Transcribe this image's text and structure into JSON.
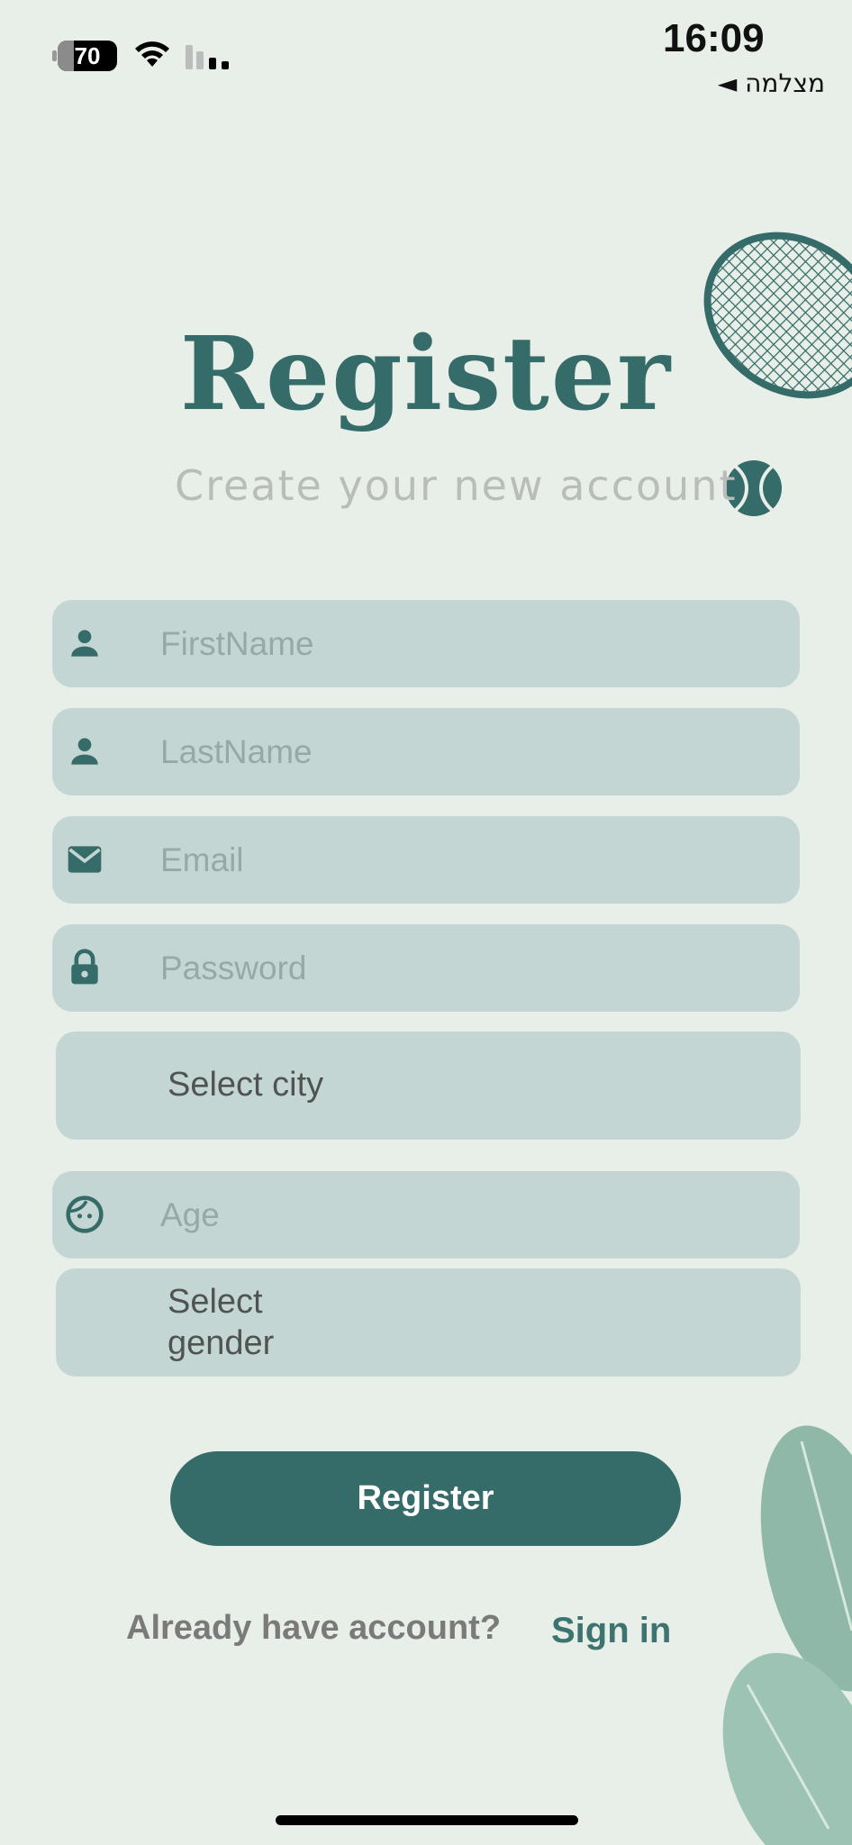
{
  "status_bar": {
    "time": "16:09",
    "back_app": "מצלמה ◄",
    "battery": "70",
    "icons": [
      "battery-icon",
      "wifi-icon",
      "cellular-signal-icon"
    ]
  },
  "header": {
    "title": "Register",
    "subtitle": "Create your new account"
  },
  "form": {
    "first_name": {
      "placeholder": "FirstName",
      "icon": "person-icon"
    },
    "last_name": {
      "placeholder": "LastName",
      "icon": "person-icon"
    },
    "email": {
      "placeholder": "Email",
      "icon": "mail-icon"
    },
    "password": {
      "placeholder": "Password",
      "icon": "lock-icon"
    },
    "city": {
      "value": "Select city"
    },
    "age": {
      "placeholder": "Age",
      "icon": "face-icon"
    },
    "gender": {
      "value_line1": "Select",
      "value_line2": "gender"
    }
  },
  "actions": {
    "register_label": "Register",
    "already_text": "Already have account?",
    "signin_label": "Sign in"
  },
  "colors": {
    "background": "#e8efe8",
    "accent": "#356b68",
    "field_bg": "#c4d6d4"
  }
}
